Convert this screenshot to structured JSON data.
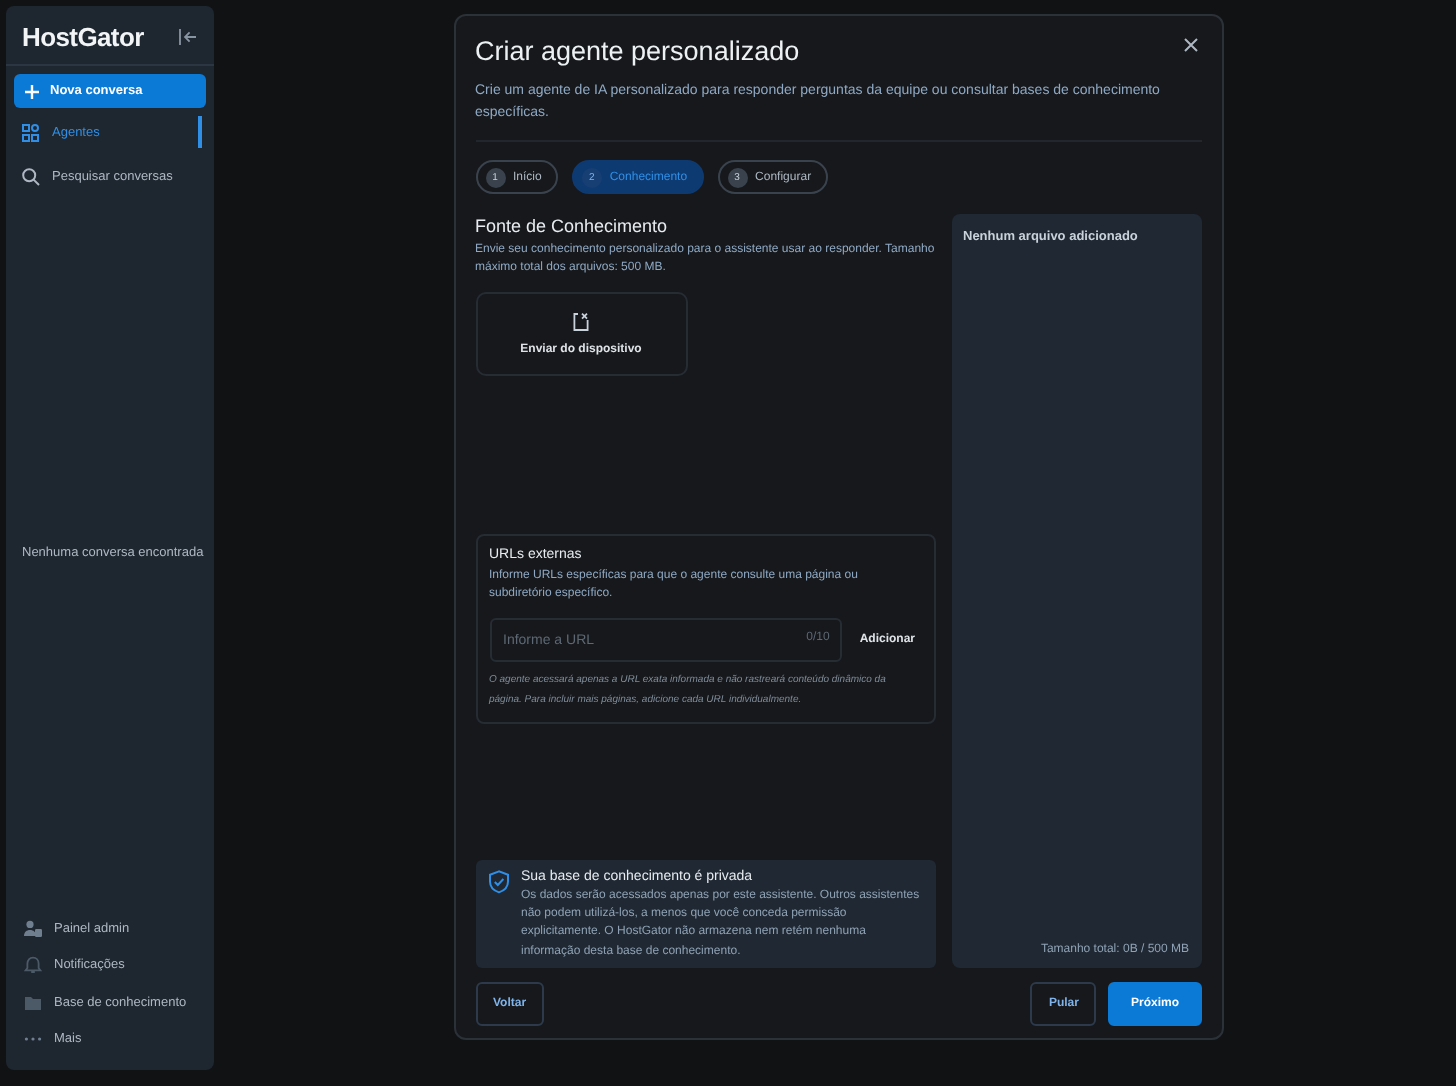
{
  "sidebar": {
    "logo": "HostGator",
    "new_chat": "Nova conversa",
    "nav": [
      {
        "label": "Agentes",
        "kind": "agents",
        "selected": true
      },
      {
        "label": "Pesquisar conversas",
        "kind": "search",
        "selected": false
      }
    ],
    "empty": "Nenhuma conversa encontrada",
    "footer": [
      {
        "label": "Painel admin",
        "kind": "admin"
      },
      {
        "label": "Notificações",
        "kind": "bell"
      },
      {
        "label": "Base de conhecimento",
        "kind": "folder"
      },
      {
        "label": "Mais",
        "kind": "more"
      }
    ]
  },
  "modal": {
    "title": "Criar agente personalizado",
    "description": "Crie um agente de IA personalizado para responder perguntas da equipe ou consultar bases de conhecimento específicas.",
    "steps": [
      {
        "number": "1",
        "label": "Início",
        "selected": false
      },
      {
        "number": "2",
        "label": "Conhecimento",
        "selected": true
      },
      {
        "number": "3",
        "label": "Configurar",
        "selected": false
      }
    ],
    "knowledge": {
      "heading": "Fonte de Conhecimento",
      "description": "Envie seu conhecimento personalizado para o assistente usar ao responder. Tamanho máximo total dos arquivos: 500 MB.",
      "upload_label": "Enviar do dispositivo"
    },
    "urls": {
      "heading": "URLs externas",
      "description": "Informe URLs específicas para que o agente consulte uma página ou subdiretório específico.",
      "placeholder": "Informe a URL",
      "counter": "0/10",
      "add_button": "Adicionar",
      "note": "O agente acessará apenas a URL exata informada e não rastreará conteúdo dinâmico da página. Para incluir mais páginas, adicione cada URL individualmente."
    },
    "privacy": {
      "heading": "Sua base de conhecimento é privada",
      "text": "Os dados serão acessados apenas por este assistente. Outros assistentes não podem utilizá-los, a menos que você conceda permissão explicitamente. O HostGator não armazena nem retém nenhuma informação desta base de conhecimento."
    },
    "files": {
      "empty": "Nenhum arquivo adicionado",
      "total": "Tamanho total: 0B / 500 MB"
    },
    "buttons": {
      "back": "Voltar",
      "skip": "Pular",
      "next": "Próximo"
    }
  }
}
